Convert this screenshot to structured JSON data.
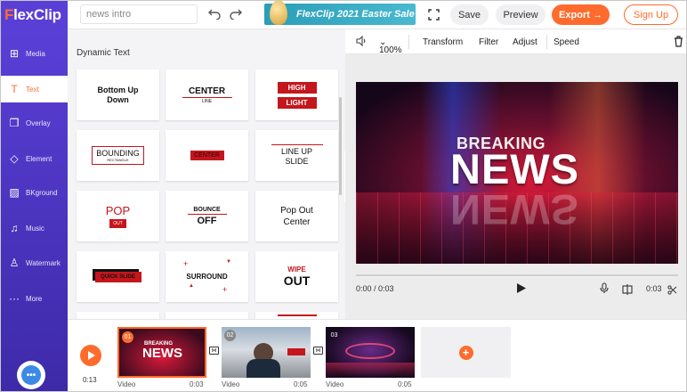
{
  "app": {
    "logo_prefix": "F",
    "logo_rest": "lexClip"
  },
  "header": {
    "project_name": "news intro",
    "promo": "FlexClip 2021 Easter Sale",
    "save": "Save",
    "preview": "Preview",
    "export": "Export →",
    "signup": "Sign Up"
  },
  "sidebar": {
    "items": [
      {
        "label": "Media",
        "icon": "media-icon"
      },
      {
        "label": "Text",
        "icon": "text-icon",
        "active": true
      },
      {
        "label": "Overlay",
        "icon": "overlay-icon"
      },
      {
        "label": "Element",
        "icon": "element-icon"
      },
      {
        "label": "BKground",
        "icon": "background-icon"
      },
      {
        "label": "Music",
        "icon": "music-icon"
      },
      {
        "label": "Watermark",
        "icon": "watermark-icon"
      },
      {
        "label": "More",
        "icon": "more-icon"
      }
    ]
  },
  "panel": {
    "title": "Dynamic Text",
    "cards": {
      "bottom_up": "Bottom Up Down",
      "center": "CENTER",
      "center_sub": "LINE",
      "high": "HIGH",
      "light": "LIGHT",
      "bounding": "BOUNDING",
      "bounding_sub": "RECTANGLE",
      "center_block": "CENTER",
      "line_up": "LINE UP SLIDE",
      "pop": "POP",
      "pop_sub": "OUT",
      "bounce": "BOUNCE",
      "bounce_sub": "OFF",
      "pop_out_center": "Pop Out Center",
      "quick_slide": "QUICK SLIDE",
      "surround": "SURROUND",
      "wipe": "WIPE",
      "wipe_sub": "OUT"
    }
  },
  "toolbar": {
    "zoom": "100%",
    "transform": "Transform",
    "filter": "Filter",
    "adjust": "Adjust",
    "speed": "Speed"
  },
  "video": {
    "line1": "BREAKING",
    "line2": "NEWS"
  },
  "player": {
    "time": "0:00 / 0:03",
    "clip_duration": "0:03",
    "progress": 0
  },
  "timeline": {
    "total": "0:13",
    "clips": [
      {
        "num": "01",
        "label": "Video",
        "duration": "0:03",
        "selected": true
      },
      {
        "num": "02",
        "label": "Video",
        "duration": "0:05",
        "selected": false
      },
      {
        "num": "03",
        "label": "Video",
        "duration": "0:05",
        "selected": false
      }
    ]
  },
  "colors": {
    "accent": "#ff6b2c",
    "sidebar": "#5a3fd6",
    "red": "#c4161c"
  }
}
